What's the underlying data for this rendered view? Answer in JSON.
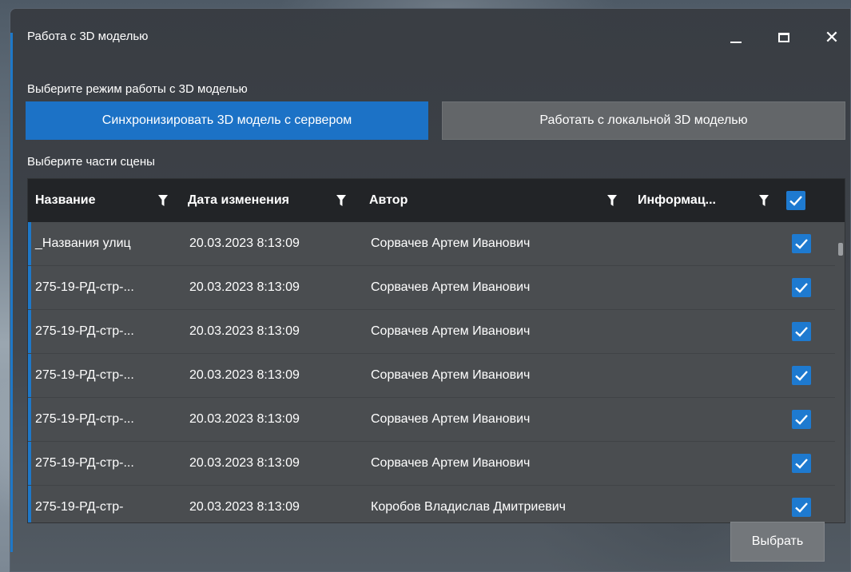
{
  "window": {
    "title": "Работа с 3D моделью",
    "minimize_icon": "minimize-icon",
    "maximize_icon": "maximize-icon",
    "close_icon": "close-icon",
    "close_glyph": "✕"
  },
  "mode": {
    "label": "Выберите режим работы с 3D моделью",
    "sync_label": "Синхронизировать 3D модель с сервером",
    "local_label": "Работать с локальной 3D моделью",
    "selected": "sync"
  },
  "parts": {
    "label": "Выберите части сцены",
    "columns": {
      "name": "Название",
      "date": "Дата изменения",
      "author": "Автор",
      "info": "Информац..."
    },
    "select_all_checked": true,
    "rows": [
      {
        "name": "_Названия улиц",
        "date": "20.03.2023 8:13:09",
        "author": "Сорвачев Артем Иванович",
        "info": "",
        "checked": true
      },
      {
        "name": "275-19-РД-стр-...",
        "date": "20.03.2023 8:13:09",
        "author": "Сорвачев Артем Иванович",
        "info": "",
        "checked": true
      },
      {
        "name": "275-19-РД-стр-...",
        "date": "20.03.2023 8:13:09",
        "author": "Сорвачев Артем Иванович",
        "info": "",
        "checked": true
      },
      {
        "name": "275-19-РД-стр-...",
        "date": "20.03.2023 8:13:09",
        "author": "Сорвачев Артем Иванович",
        "info": "",
        "checked": true
      },
      {
        "name": "275-19-РД-стр-...",
        "date": "20.03.2023 8:13:09",
        "author": "Сорвачев Артем Иванович",
        "info": "",
        "checked": true
      },
      {
        "name": "275-19-РД-стр-...",
        "date": "20.03.2023 8:13:09",
        "author": "Сорвачев Артем Иванович",
        "info": "",
        "checked": true
      },
      {
        "name": "275-19-РД-стр-",
        "date": "20.03.2023 8:13:09",
        "author": "Коробов Владислав Дмитриевич",
        "info": "",
        "checked": true
      }
    ]
  },
  "footer": {
    "select_label": "Выбрать"
  },
  "colors": {
    "accent": "#1c72c6",
    "header_bg": "#222427",
    "row_bg": "#4a4d50"
  }
}
